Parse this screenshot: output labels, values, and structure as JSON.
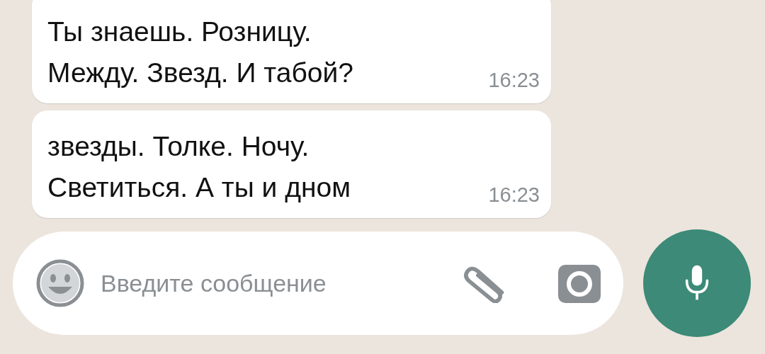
{
  "messages": [
    {
      "text": "Ты знаешь. Розницу.\nМежду. Звезд. И табой?",
      "time": "16:23"
    },
    {
      "text": "звезды. Толке. Ночу.\nСветиться. А ты и дном",
      "time": "16:23"
    }
  ],
  "composer": {
    "placeholder": "Введите сообщение"
  }
}
